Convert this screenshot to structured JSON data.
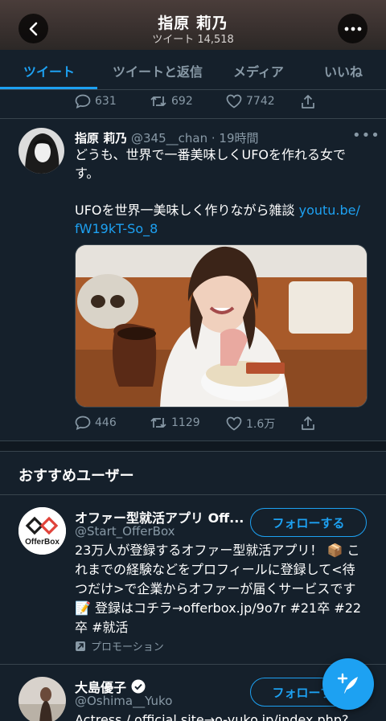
{
  "header": {
    "title": "指原 莉乃",
    "tweet_count": "ツイート 14,518"
  },
  "tabs": [
    "ツイート",
    "ツイートと返信",
    "メディア",
    "いいね"
  ],
  "prev_tweet_actions": {
    "replies": "631",
    "retweets": "692",
    "likes": "7742"
  },
  "tweet": {
    "name": "指原 莉乃",
    "handle_time": "@345__chan · 19時間",
    "text_line1": "どうも、世界で一番美味しくUFOを作れる女で",
    "text_line2": "す。",
    "text_line3": "UFOを世界一美味しく作りながら雑談 ",
    "link_part1": "youtu.be/",
    "link_part2": "fW19kT-So_8",
    "replies": "446",
    "retweets": "1129",
    "likes": "1.6万"
  },
  "recommend": {
    "title": "おすすめユーザー",
    "user1": {
      "name": "オファー型就活アプリ Off...",
      "handle": "@Start_OfferBox",
      "follow": "フォローする",
      "logo_text": "OfferBox",
      "bio_l1": "23万人が登録するオファー型就活アプリ！ 📦 こ",
      "bio_l2": "れまでの経験などをプロフィールに登録して<待",
      "bio_l3": "つだけ>で企業からオファーが届くサービスです",
      "bio_l4": "📝 登録はコチラ→offerbox.jp/9o7r #21卒 #22",
      "bio_l5": "卒 #就活",
      "promo": "プロモーション"
    },
    "user2": {
      "name": "大島優子",
      "handle": "@Oshima__Yuko",
      "follow": "フォローする",
      "bio": "Actress / official site→o-yuko.jp/index.php?"
    }
  },
  "colors": {
    "accent": "#1da1f2",
    "background": "#15202b",
    "muted": "#8899a6"
  }
}
